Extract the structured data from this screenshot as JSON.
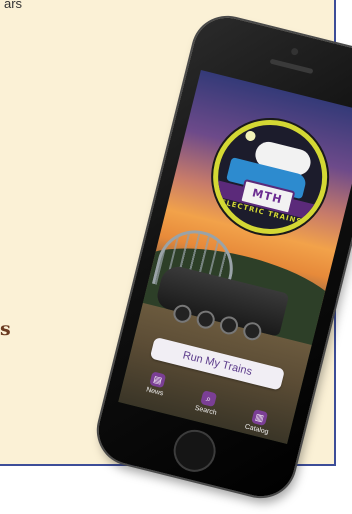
{
  "panel": {
    "top_text": "ars",
    "bold_text": "s"
  },
  "app": {
    "logo": {
      "mark": "MTH",
      "subtitle": "ELECTRIC TRAINS"
    },
    "run_button_label": "Run My Trains",
    "tabs": [
      {
        "label": "News",
        "icon": "news-icon"
      },
      {
        "label": "Search",
        "icon": "search-icon"
      },
      {
        "label": "Catalog",
        "icon": "catalog-icon"
      }
    ]
  },
  "colors": {
    "panel_bg": "#fbf1d6",
    "panel_border": "#3d4d98",
    "accent_purple": "#7b3f95",
    "logo_ring": "#d4d834",
    "bold_text": "#6b3a20"
  }
}
